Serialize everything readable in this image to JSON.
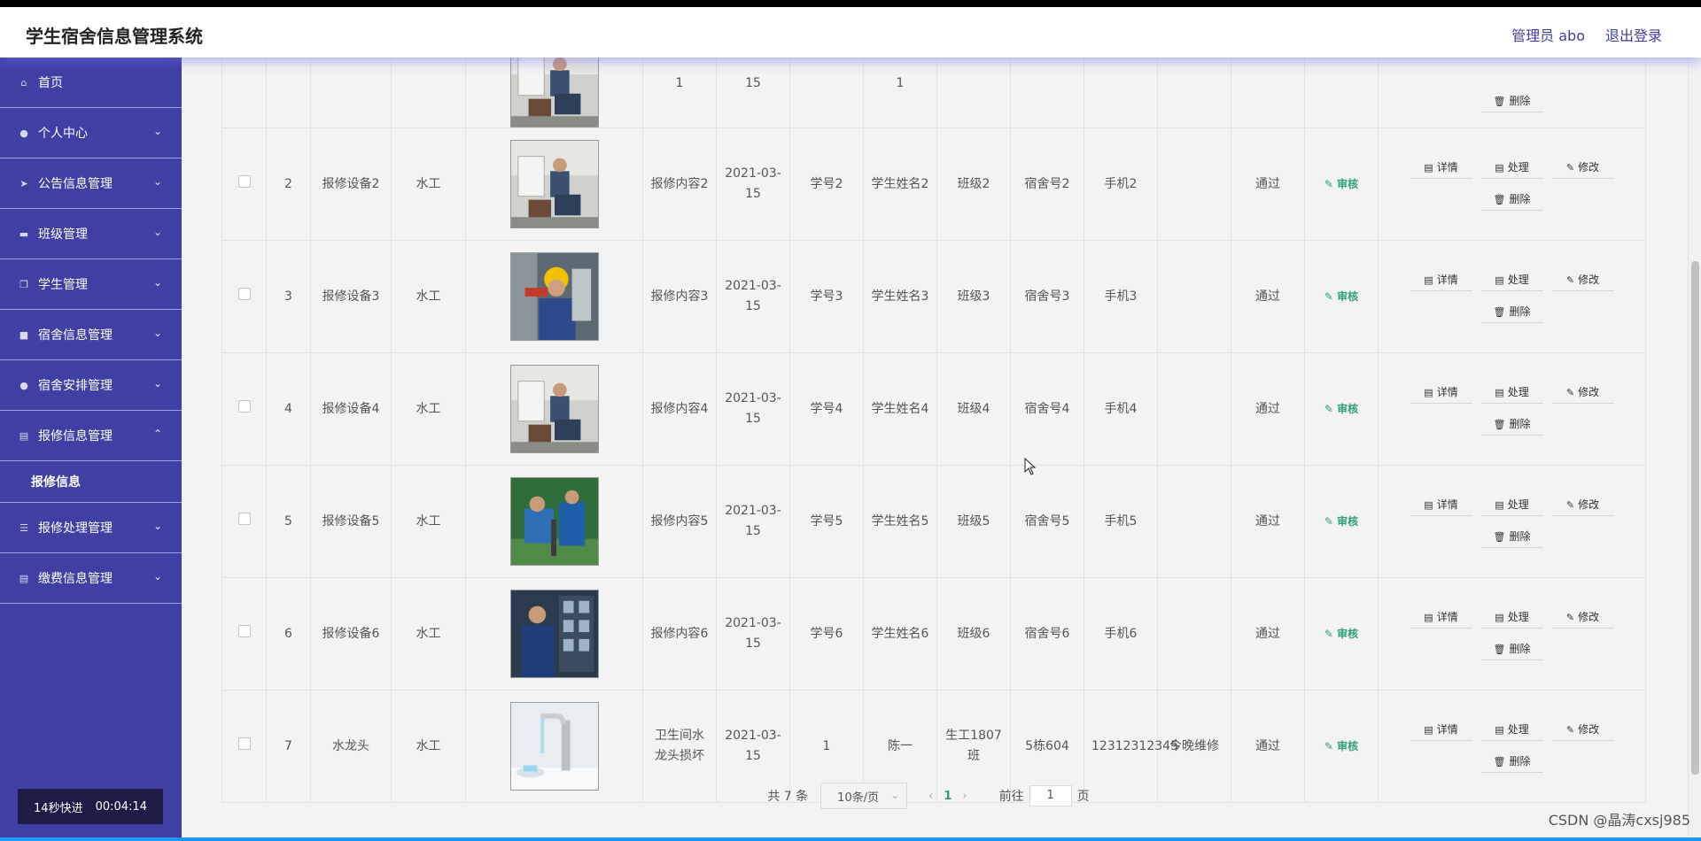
{
  "header": {
    "title": "学生宿舍信息管理系统",
    "admin": "管理员 abo",
    "logout": "退出登录"
  },
  "sidebar": {
    "items": [
      {
        "label": "首页",
        "icon": "home-icon",
        "glyph": "⌂",
        "expandable": false
      },
      {
        "label": "个人中心",
        "icon": "user-icon",
        "glyph": "●",
        "expandable": true
      },
      {
        "label": "公告信息管理",
        "icon": "send-icon",
        "glyph": "➤",
        "expandable": true
      },
      {
        "label": "班级管理",
        "icon": "board-icon",
        "glyph": "▬",
        "expandable": true
      },
      {
        "label": "学生管理",
        "icon": "copy-icon",
        "glyph": "❐",
        "expandable": true
      },
      {
        "label": "宿舍信息管理",
        "icon": "briefcase-icon",
        "glyph": "■",
        "expandable": true
      },
      {
        "label": "宿舍安排管理",
        "icon": "person-icon",
        "glyph": "●",
        "expandable": true
      },
      {
        "label": "报修信息管理",
        "icon": "clipboard-icon",
        "glyph": "▤",
        "expandable": true,
        "open": true,
        "children": [
          "报修信息"
        ]
      },
      {
        "label": "报修处理管理",
        "icon": "list-icon",
        "glyph": "☰",
        "expandable": true
      },
      {
        "label": "缴费信息管理",
        "icon": "note-icon",
        "glyph": "▤",
        "expandable": true
      }
    ]
  },
  "ff_badge": {
    "label": "14秒快进",
    "time": "00:04:14"
  },
  "ops": {
    "detail": "详情",
    "handle": "处理",
    "edit": "修改",
    "delete": "删除"
  },
  "audit_label": "审核",
  "rows": [
    {
      "no": "",
      "device": "",
      "type": "",
      "photo": "plumber",
      "content": "1",
      "date": "15",
      "sid": "",
      "sname": "1",
      "cls": "",
      "dorm": "",
      "phone": "",
      "remark": "",
      "status": "",
      "partial": true
    },
    {
      "no": "2",
      "device": "报修设备2",
      "type": "水工",
      "photo": "plumber",
      "content": "报修内容2",
      "date": "2021-03-15",
      "sid": "学号2",
      "sname": "学生姓名2",
      "cls": "班级2",
      "dorm": "宿舍号2",
      "phone": "手机2",
      "remark": "",
      "status": "通过"
    },
    {
      "no": "3",
      "device": "报修设备3",
      "type": "水工",
      "photo": "helmet",
      "content": "报修内容3",
      "date": "2021-03-15",
      "sid": "学号3",
      "sname": "学生姓名3",
      "cls": "班级3",
      "dorm": "宿舍号3",
      "phone": "手机3",
      "remark": "",
      "status": "通过"
    },
    {
      "no": "4",
      "device": "报修设备4",
      "type": "水工",
      "photo": "plumber",
      "content": "报修内容4",
      "date": "2021-03-15",
      "sid": "学号4",
      "sname": "学生姓名4",
      "cls": "班级4",
      "dorm": "宿舍号4",
      "phone": "手机4",
      "remark": "",
      "status": "通过"
    },
    {
      "no": "5",
      "device": "报修设备5",
      "type": "水工",
      "photo": "green",
      "content": "报修内容5",
      "date": "2021-03-15",
      "sid": "学号5",
      "sname": "学生姓名5",
      "cls": "班级5",
      "dorm": "宿舍号5",
      "phone": "手机5",
      "remark": "",
      "status": "通过"
    },
    {
      "no": "6",
      "device": "报修设备6",
      "type": "水工",
      "photo": "panel",
      "content": "报修内容6",
      "date": "2021-03-15",
      "sid": "学号6",
      "sname": "学生姓名6",
      "cls": "班级6",
      "dorm": "宿舍号6",
      "phone": "手机6",
      "remark": "",
      "status": "通过"
    },
    {
      "no": "7",
      "device": "水龙头",
      "type": "水工",
      "photo": "faucet",
      "content": "卫生间水龙头损坏",
      "date": "2021-03-15",
      "sid": "1",
      "sname": "陈一",
      "cls": "生工1807班",
      "dorm": "5栋604",
      "phone": "12312312345",
      "remark": "今晚维修",
      "status": "通过"
    }
  ],
  "pagination": {
    "total": "共 7 条",
    "page_size": "10条/页",
    "current": "1",
    "goto_label": "前往",
    "goto_value": "1",
    "page_suffix": "页"
  },
  "watermark": "CSDN @晶涛cxsj985"
}
